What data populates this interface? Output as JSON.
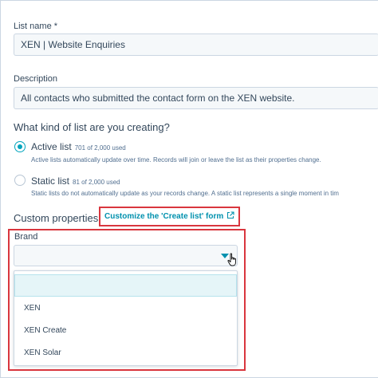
{
  "list_name": {
    "label": "List name *",
    "value": "XEN | Website Enquiries"
  },
  "description": {
    "label": "Description",
    "value": "All contacts who submitted the contact form on the XEN website."
  },
  "list_type": {
    "question": "What kind of list are you creating?",
    "options": [
      {
        "title": "Active list",
        "count": "701 of 2,000 used",
        "description": "Active lists automatically update over time. Records will join or leave the list as their properties change.",
        "selected": true
      },
      {
        "title": "Static list",
        "count": "81 of 2,000 used",
        "description": "Static lists do not automatically update as your records change. A static list represents a single moment in tim",
        "selected": false
      }
    ]
  },
  "custom_properties": {
    "heading": "Custom properties",
    "customize_link": "Customize the 'Create list' form",
    "link_icon": "external-link-icon"
  },
  "brand": {
    "label": "Brand",
    "selected_value": "",
    "options": [
      "",
      "XEN",
      "XEN Create",
      "XEN Solar"
    ]
  },
  "colors": {
    "accent": "#00a4bd",
    "link": "#0091ae",
    "highlight_box": "#d9363e",
    "text": "#33475b"
  }
}
